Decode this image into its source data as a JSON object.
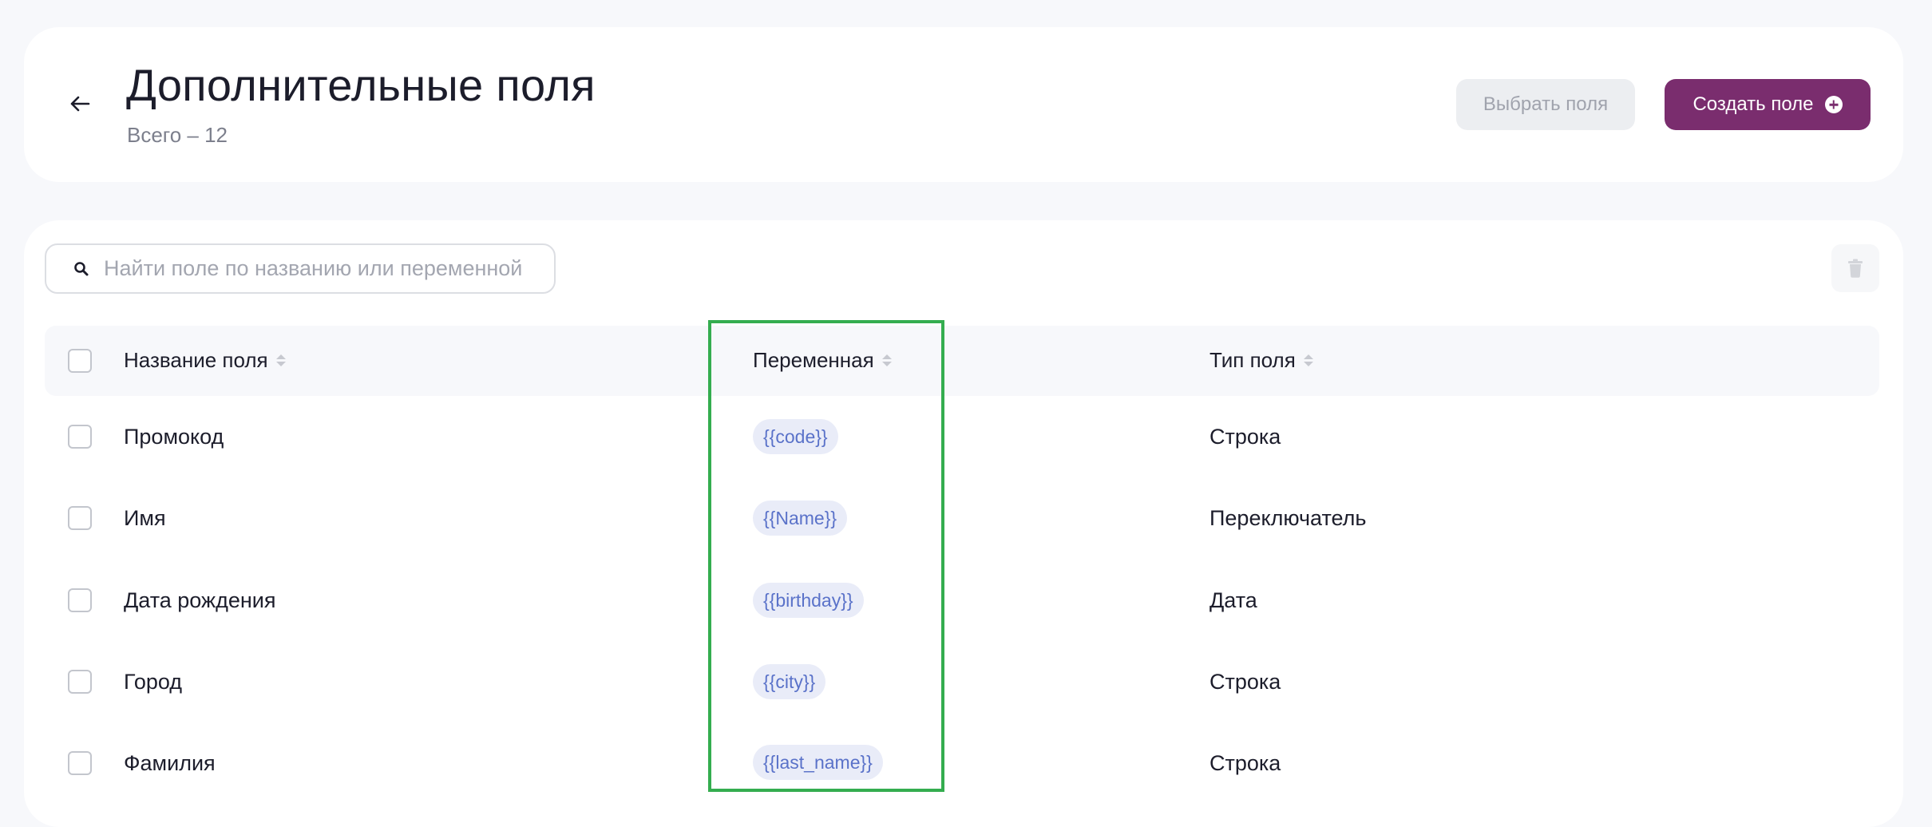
{
  "header": {
    "title": "Дополнительные поля",
    "subtitle": "Всего – 12",
    "select_fields_label": "Выбрать поля",
    "create_field_label": "Создать поле"
  },
  "search": {
    "placeholder": "Найти поле по названию или переменной",
    "value": ""
  },
  "table": {
    "columns": {
      "name": "Название поля",
      "variable": "Переменная",
      "type": "Тип поля"
    },
    "rows": [
      {
        "name": "Промокод",
        "variable": "{{code}}",
        "type": "Строка"
      },
      {
        "name": "Имя",
        "variable": "{{Name}}",
        "type": "Переключатель"
      },
      {
        "name": "Дата рождения",
        "variable": "{{birthday}}",
        "type": "Дата"
      },
      {
        "name": "Город",
        "variable": "{{city}}",
        "type": "Строка"
      },
      {
        "name": "Фамилия",
        "variable": "{{last_name}}",
        "type": "Строка"
      }
    ]
  },
  "colors": {
    "primary": "#7a2d6e",
    "chip_bg": "#e9ecf8",
    "chip_text": "#5a72c9",
    "highlight": "#34ad4f"
  },
  "icons": {
    "back": "arrow-left-icon",
    "search": "search-icon",
    "trash": "trash-icon",
    "plus": "plus-circle-icon",
    "sort": "sort-icon"
  }
}
